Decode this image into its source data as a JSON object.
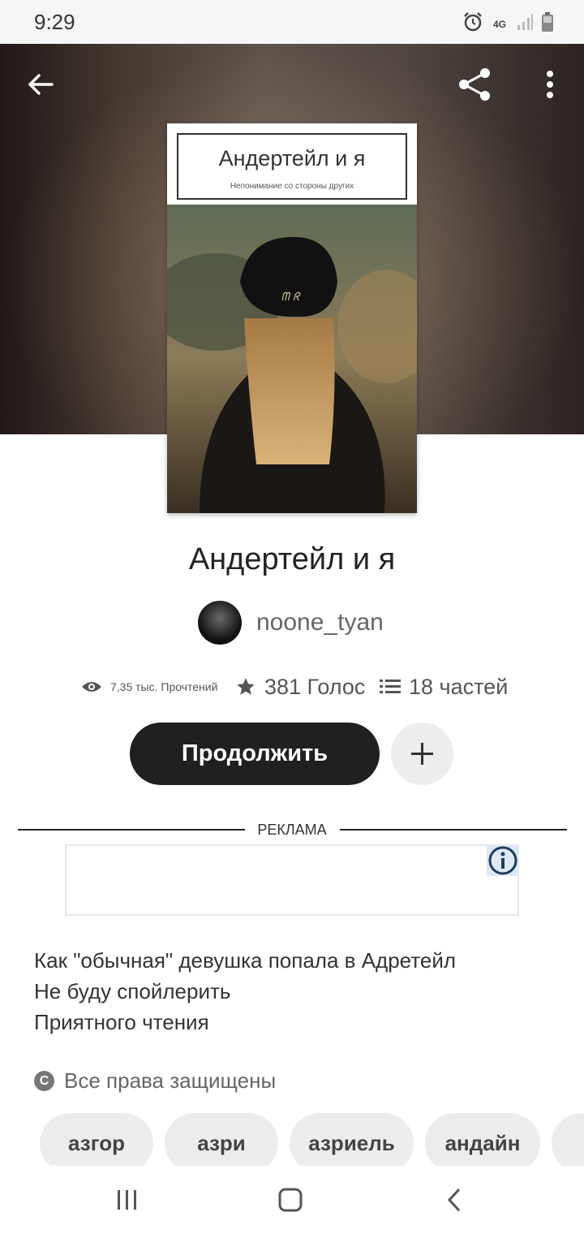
{
  "status_bar": {
    "time": "9:29",
    "network": "4G",
    "icons": [
      "alarm-icon",
      "network-4g-icon",
      "signal-icon",
      "battery-icon"
    ]
  },
  "toolbar": {
    "icons": [
      "back-arrow-icon",
      "share-icon",
      "more-vertical-icon"
    ]
  },
  "cover": {
    "title": "Андертейл и я",
    "subtitle": "Непонимание со стороны других"
  },
  "story": {
    "title": "Андертейл и я",
    "author": "noone_tyan",
    "stats": {
      "reads": "7,35 тыс. Прочтений",
      "votes": "381 Голос",
      "parts": "18 частей"
    },
    "continue_label": "Продолжить",
    "description": [
      "Как \"обычная\" девушка попала в Адретейл",
      "Не буду спойлерить",
      "Приятного чтения"
    ],
    "copyright": "Все права защищены",
    "tags": [
      "азгор",
      "азри",
      "азриель",
      "андайн"
    ]
  },
  "ad": {
    "label": "РЕКЛАМА"
  },
  "nav_bar": {
    "icons": [
      "recent-apps-icon",
      "home-icon",
      "back-icon"
    ]
  },
  "colors": {
    "primary_button": "#221f1f",
    "secondary_button": "#ededed",
    "tag_background": "#ececec",
    "text_secondary": "#666666"
  }
}
